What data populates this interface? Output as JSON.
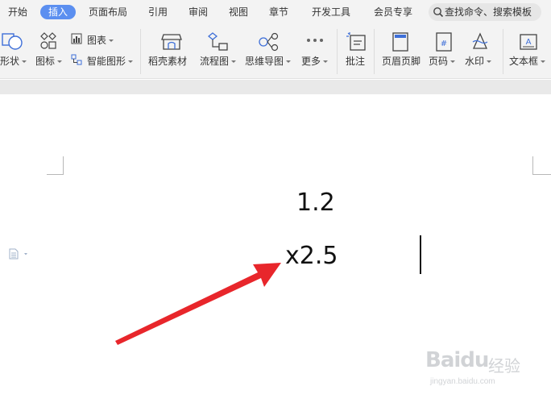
{
  "tabs": [
    {
      "label": "开始"
    },
    {
      "label": "插入",
      "active": true
    },
    {
      "label": "页面布局"
    },
    {
      "label": "引用"
    },
    {
      "label": "审阅"
    },
    {
      "label": "视图"
    },
    {
      "label": "章节"
    },
    {
      "label": "开发工具"
    },
    {
      "label": "会员专享"
    }
  ],
  "search": {
    "placeholder": "查找命令、搜索模板"
  },
  "ribbon": {
    "shape": "形状",
    "icon": "图标",
    "chart": "图表",
    "smart_graphic": "智能图形",
    "daoke": "稻壳素材",
    "flowchart": "流程图",
    "mindmap": "思维导图",
    "more": "更多",
    "comment": "批注",
    "header_footer": "页眉页脚",
    "page_number": "页码",
    "watermark": "水印",
    "textbox": "文本框"
  },
  "document": {
    "line1": "1.2",
    "line2": "x2.5"
  },
  "watermark": {
    "logo": "Baidu",
    "cn": "经验",
    "url": "jingyan.baidu.com"
  },
  "colors": {
    "accent": "#5b8ff0",
    "arrow": "#e8262b",
    "ribbon_bg": "#f3f3f3"
  }
}
